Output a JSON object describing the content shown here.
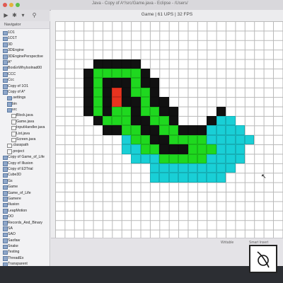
{
  "window": {
    "title": "Java - Copy of A*/src/Game.java - Eclipse - /Users/",
    "game_title": "Game | 61 UPS | 32 FPS"
  },
  "navigator": {
    "header": "Navigator",
    "items": [
      {
        "label": "1O1",
        "indent": 0,
        "type": "folder"
      },
      {
        "label": "1O1T",
        "indent": 0,
        "type": "folder"
      },
      {
        "label": "3D",
        "indent": 0,
        "type": "folder"
      },
      {
        "label": "3DEngine",
        "indent": 0,
        "type": "folder"
      },
      {
        "label": "3DEnginePerspective",
        "indent": 0,
        "type": "folder"
      },
      {
        "label": "A*",
        "indent": 0,
        "type": "folder"
      },
      {
        "label": "BoxEnWhyIsolnad00",
        "indent": 0,
        "type": "folder"
      },
      {
        "label": "CCC",
        "indent": 0,
        "type": "folder"
      },
      {
        "label": "Ccc",
        "indent": 0,
        "type": "folder"
      },
      {
        "label": "Copy of 1O1",
        "indent": 0,
        "type": "folder"
      },
      {
        "label": "Copy of A*",
        "indent": 0,
        "type": "folder"
      },
      {
        "label": ".settings",
        "indent": 1,
        "type": "folder"
      },
      {
        "label": "bin",
        "indent": 1,
        "type": "folder"
      },
      {
        "label": "src",
        "indent": 1,
        "type": "folder"
      },
      {
        "label": "Block.java",
        "indent": 2,
        "type": "file"
      },
      {
        "label": "Game.java",
        "indent": 2,
        "type": "file"
      },
      {
        "label": "InputHandler.java",
        "indent": 2,
        "type": "file"
      },
      {
        "label": "List.java",
        "indent": 2,
        "type": "file"
      },
      {
        "label": "Screen.java",
        "indent": 2,
        "type": "file"
      },
      {
        "label": ".classpath",
        "indent": 1,
        "type": "file"
      },
      {
        "label": ".project",
        "indent": 1,
        "type": "file"
      },
      {
        "label": "Copy of Game_of_Life",
        "indent": 0,
        "type": "folder"
      },
      {
        "label": "Copy of Illusion",
        "indent": 0,
        "type": "folder"
      },
      {
        "label": "Copy of E3Trial",
        "indent": 0,
        "type": "folder"
      },
      {
        "label": "Cube3D",
        "indent": 0,
        "type": "folder"
      },
      {
        "label": "Gs",
        "indent": 0,
        "type": "folder"
      },
      {
        "label": "Game",
        "indent": 0,
        "type": "folder"
      },
      {
        "label": "Game_of_Life",
        "indent": 0,
        "type": "folder"
      },
      {
        "label": "Gamere",
        "indent": 0,
        "type": "folder"
      },
      {
        "label": "Illusion",
        "indent": 0,
        "type": "folder"
      },
      {
        "label": "LeapMotion",
        "indent": 0,
        "type": "folder"
      },
      {
        "label": "OO",
        "indent": 0,
        "type": "folder"
      },
      {
        "label": "Records_And_Binary",
        "indent": 0,
        "type": "folder"
      },
      {
        "label": "SA",
        "indent": 0,
        "type": "folder"
      },
      {
        "label": "SAO",
        "indent": 0,
        "type": "folder"
      },
      {
        "label": "Saofaw",
        "indent": 0,
        "type": "folder"
      },
      {
        "label": "Snake",
        "indent": 0,
        "type": "folder"
      },
      {
        "label": "Testing",
        "indent": 0,
        "type": "folder"
      },
      {
        "label": "ThreadEx",
        "indent": 0,
        "type": "folder"
      },
      {
        "label": "Transparent",
        "indent": 0,
        "type": "folder"
      }
    ]
  },
  "grid": {
    "colors": {
      "wall": "#111111",
      "green": "#1fd81f",
      "cyan": "#19cfd6",
      "red": "#e8331f",
      "empty": "#ffffff",
      "line": "#b9b9b9"
    },
    "rows": [
      "......................",
      "......................",
      "......................",
      "......................",
      "....WWWWW.............",
      "...WGGGGGW............",
      "...WGWWWGWW...........",
      "...WGWRWGGW...........",
      "...WGWRWWGWW..........",
      "...WGWGGWGGWW....W....",
      "....WGGGWWGGW...WCC...",
      ".....WWGGWWGGWWWCCCC..",
      ".......CGGWWGGGGCCCCC.",
      ".......CCGGWWWGGGCCC..",
      "........CCCGGGGGCCCC..",
      "..........CCCCCCCCC...",
      "..........CCCCCCCC....",
      "......................",
      "......................",
      "......................",
      "......................",
      "......................",
      "......................"
    ]
  },
  "statusbar": {
    "left": "Writable",
    "right": "Smart Insert"
  }
}
